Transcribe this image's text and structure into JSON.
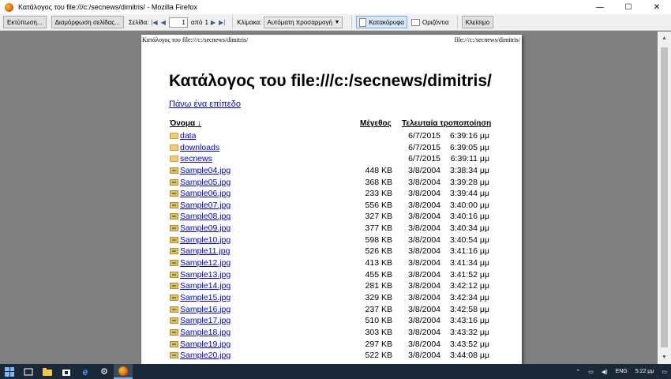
{
  "window": {
    "title": "Κατάλογος του file:///c:/secnews/dimitris/ - Mozilla Firefox",
    "minimize": "—",
    "maximize": "☐",
    "close": "✕"
  },
  "toolbar": {
    "print_label": "Εκτύπωση...",
    "page_setup_label": "Διαμόρφωση σελίδας...",
    "page_label": "Σελίδα:",
    "first": "|◀",
    "prev": "◀",
    "page_value": "1",
    "of_label": "από",
    "page_total": "1",
    "next": "▶",
    "last": "▶|",
    "scale_label": "Κλίμακα:",
    "scale_value": "Αυτόματη προσαρμογή",
    "portrait_label": "Κατακόρυφα",
    "landscape_label": "Οριζόντια",
    "close_label": "Κλείσιμο"
  },
  "page": {
    "header_left": "Κατάλογος του file:///c:/secnews/dimitris/",
    "header_right": "file:///c:/secnews/dimitris/",
    "heading": "Κατάλογος του file:///c:/secnews/dimitris/",
    "up_link": "Πάνω ένα επίπεδο",
    "columns": {
      "name": "Όνομα ↓",
      "size": "Μέγεθος",
      "modified": "Τελευταία τροποποίηση"
    },
    "rows": [
      {
        "type": "folder",
        "name": "data",
        "size": "",
        "date": "6/7/2015",
        "time": "6:39:16 μμ"
      },
      {
        "type": "folder",
        "name": "downloads",
        "size": "",
        "date": "6/7/2015",
        "time": "6:39:05 μμ"
      },
      {
        "type": "folder",
        "name": "secnews",
        "size": "",
        "date": "6/7/2015",
        "time": "6:39:11 μμ"
      },
      {
        "type": "file",
        "name": "Sample04.jpg",
        "size": "448 KB",
        "date": "3/8/2004",
        "time": "3:38:34 μμ"
      },
      {
        "type": "file",
        "name": "Sample05.jpg",
        "size": "368 KB",
        "date": "3/8/2004",
        "time": "3:39:28 μμ"
      },
      {
        "type": "file",
        "name": "Sample06.jpg",
        "size": "233 KB",
        "date": "3/8/2004",
        "time": "3:39:44 μμ"
      },
      {
        "type": "file",
        "name": "Sample07.jpg",
        "size": "556 KB",
        "date": "3/8/2004",
        "time": "3:40:00 μμ"
      },
      {
        "type": "file",
        "name": "Sample08.jpg",
        "size": "327 KB",
        "date": "3/8/2004",
        "time": "3:40:16 μμ"
      },
      {
        "type": "file",
        "name": "Sample09.jpg",
        "size": "377 KB",
        "date": "3/8/2004",
        "time": "3:40:34 μμ"
      },
      {
        "type": "file",
        "name": "Sample10.jpg",
        "size": "598 KB",
        "date": "3/8/2004",
        "time": "3:40:54 μμ"
      },
      {
        "type": "file",
        "name": "Sample11.jpg",
        "size": "526 KB",
        "date": "3/8/2004",
        "time": "3:41:16 μμ"
      },
      {
        "type": "file",
        "name": "Sample12.jpg",
        "size": "413 KB",
        "date": "3/8/2004",
        "time": "3:41:34 μμ"
      },
      {
        "type": "file",
        "name": "Sample13.jpg",
        "size": "455 KB",
        "date": "3/8/2004",
        "time": "3:41:52 μμ"
      },
      {
        "type": "file",
        "name": "Sample14.jpg",
        "size": "281 KB",
        "date": "3/8/2004",
        "time": "3:42:12 μμ"
      },
      {
        "type": "file",
        "name": "Sample15.jpg",
        "size": "329 KB",
        "date": "3/8/2004",
        "time": "3:42:34 μμ"
      },
      {
        "type": "file",
        "name": "Sample16.jpg",
        "size": "237 KB",
        "date": "3/8/2004",
        "time": "3:42:58 μμ"
      },
      {
        "type": "file",
        "name": "Sample17.jpg",
        "size": "510 KB",
        "date": "3/8/2004",
        "time": "3:43:16 μμ"
      },
      {
        "type": "file",
        "name": "Sample18.jpg",
        "size": "303 KB",
        "date": "3/8/2004",
        "time": "3:43:32 μμ"
      },
      {
        "type": "file",
        "name": "Sample19.jpg",
        "size": "297 KB",
        "date": "3/8/2004",
        "time": "3:43:52 μμ"
      },
      {
        "type": "file",
        "name": "Sample20.jpg",
        "size": "522 KB",
        "date": "3/8/2004",
        "time": "3:44:08 μμ"
      }
    ]
  },
  "taskbar": {
    "language": "ENG",
    "clock": "5:22 μμ",
    "icons": [
      "start-icon",
      "task-view-icon",
      "file-explorer-icon",
      "store-icon",
      "internet-explorer-icon",
      "settings-icon",
      "firefox-icon"
    ]
  }
}
